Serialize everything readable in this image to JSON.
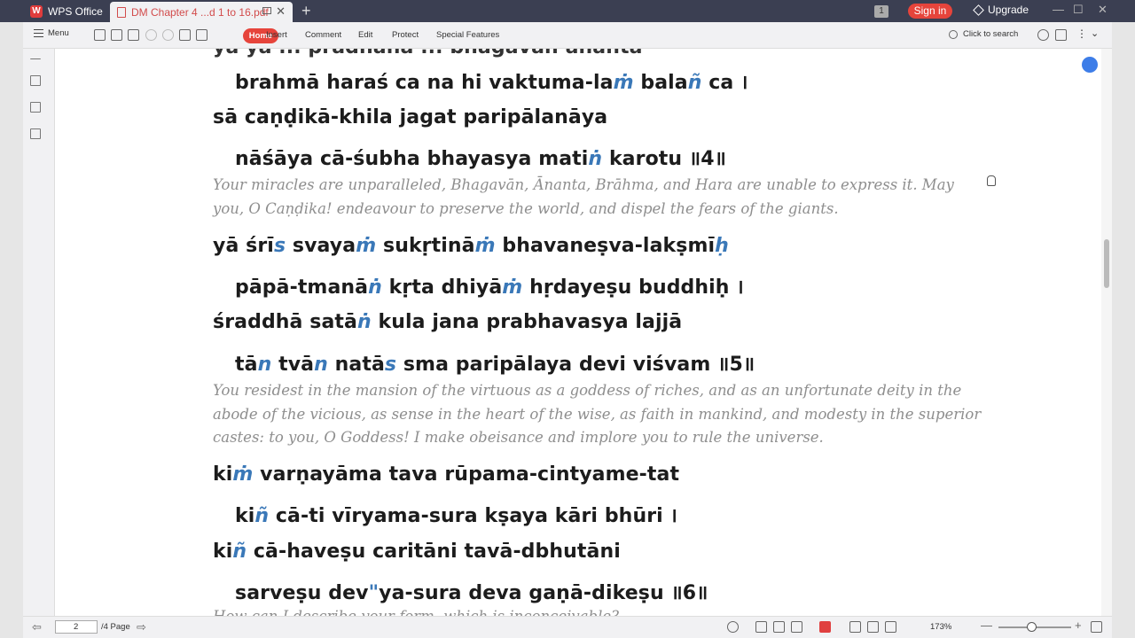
{
  "app": {
    "name": "WPS Office",
    "doc_tab": "DM Chapter 4 ...d 1 to 16.pdf",
    "tab_close": "✕",
    "add_tab": "+",
    "badge_num": "1",
    "signin": "Sign in",
    "upgrade": "Upgrade",
    "win_min": "—",
    "win_max": "☐",
    "win_close": "✕"
  },
  "toolbar": {
    "menu": "Menu",
    "home": "Home",
    "insert": "Insert",
    "comment": "Comment",
    "edit": "Edit",
    "protect": "Protect",
    "special": "Special Features",
    "search": "Click to search"
  },
  "doc": {
    "top_cut": "yā yā ... pradhānā ... bhagavān ananta",
    "lines": [
      {
        "id": "l1",
        "parts": [
          "brahmā haraś ca na hi vaktuma-la",
          "ṁ",
          " bala",
          "ñ",
          " ca ।"
        ]
      },
      {
        "id": "l2",
        "parts": [
          "sā caṇḍikā-khila jagat paripālanāya"
        ]
      },
      {
        "id": "l3",
        "parts": [
          "nāśāya cā-śubha bhayasya mati",
          "ṅ",
          " karotu ॥4॥"
        ]
      },
      {
        "id": "l4",
        "parts": [
          "yā śrī",
          "s",
          " svaya",
          "ṁ",
          " sukṛtinā",
          "ṁ",
          " bhavaneṣva-lakṣmī",
          "ḥ"
        ]
      },
      {
        "id": "l5",
        "parts": [
          "pāpā-tmanā",
          "ṅ",
          " kṛta dhiyā",
          "ṁ",
          " hṛdayeṣu buddhiḥ ।"
        ]
      },
      {
        "id": "l6",
        "parts": [
          "śraddhā satā",
          "ṅ",
          " kula jana prabhavasya lajjā"
        ]
      },
      {
        "id": "l7",
        "parts": [
          "tā",
          "n",
          " tvā",
          "n",
          " natā",
          "s",
          " sma paripālaya devi viśvam ॥5॥"
        ]
      },
      {
        "id": "l8",
        "parts": [
          "ki",
          "ṁ",
          " varṇayāma tava rūpama-cintyame-tat"
        ]
      },
      {
        "id": "l9",
        "parts": [
          "ki",
          "ñ",
          " cā-ti vīryama-sura kṣaya kāri bhūri ।"
        ]
      },
      {
        "id": "l10",
        "parts": [
          "ki",
          "ñ",
          " cā-haveṣu caritāni tavā-dbhutāni"
        ]
      },
      {
        "id": "l11",
        "parts": [
          "sarveṣu dev",
          "\"",
          "ya-sura deva gaṇā-dikeṣu ॥6॥"
        ]
      }
    ],
    "translations": [
      [
        "Your miracles are unparalleled, Bhagavān, Ānanta, Brāhma, and Hara are unable to express it. May",
        "you, O Caṇḍika! endeavour to preserve the world, and dispel the fears of the giants."
      ],
      [
        "You residest in the mansion of the virtuous as a goddess of riches, and as an unfortunate deity in the",
        "abode of the vicious, as sense in the heart of the wise, as faith in mankind, and modesty in the superior",
        "castes: to you, O Goddess! I make obeisance and implore you to rule the universe."
      ]
    ],
    "bottom_cut": "How can I describe your form, which is inconceivable? ..."
  },
  "status": {
    "page": "2",
    "total": "/4 Page",
    "zoom": "173%",
    "minus": "—",
    "plus": "+"
  }
}
